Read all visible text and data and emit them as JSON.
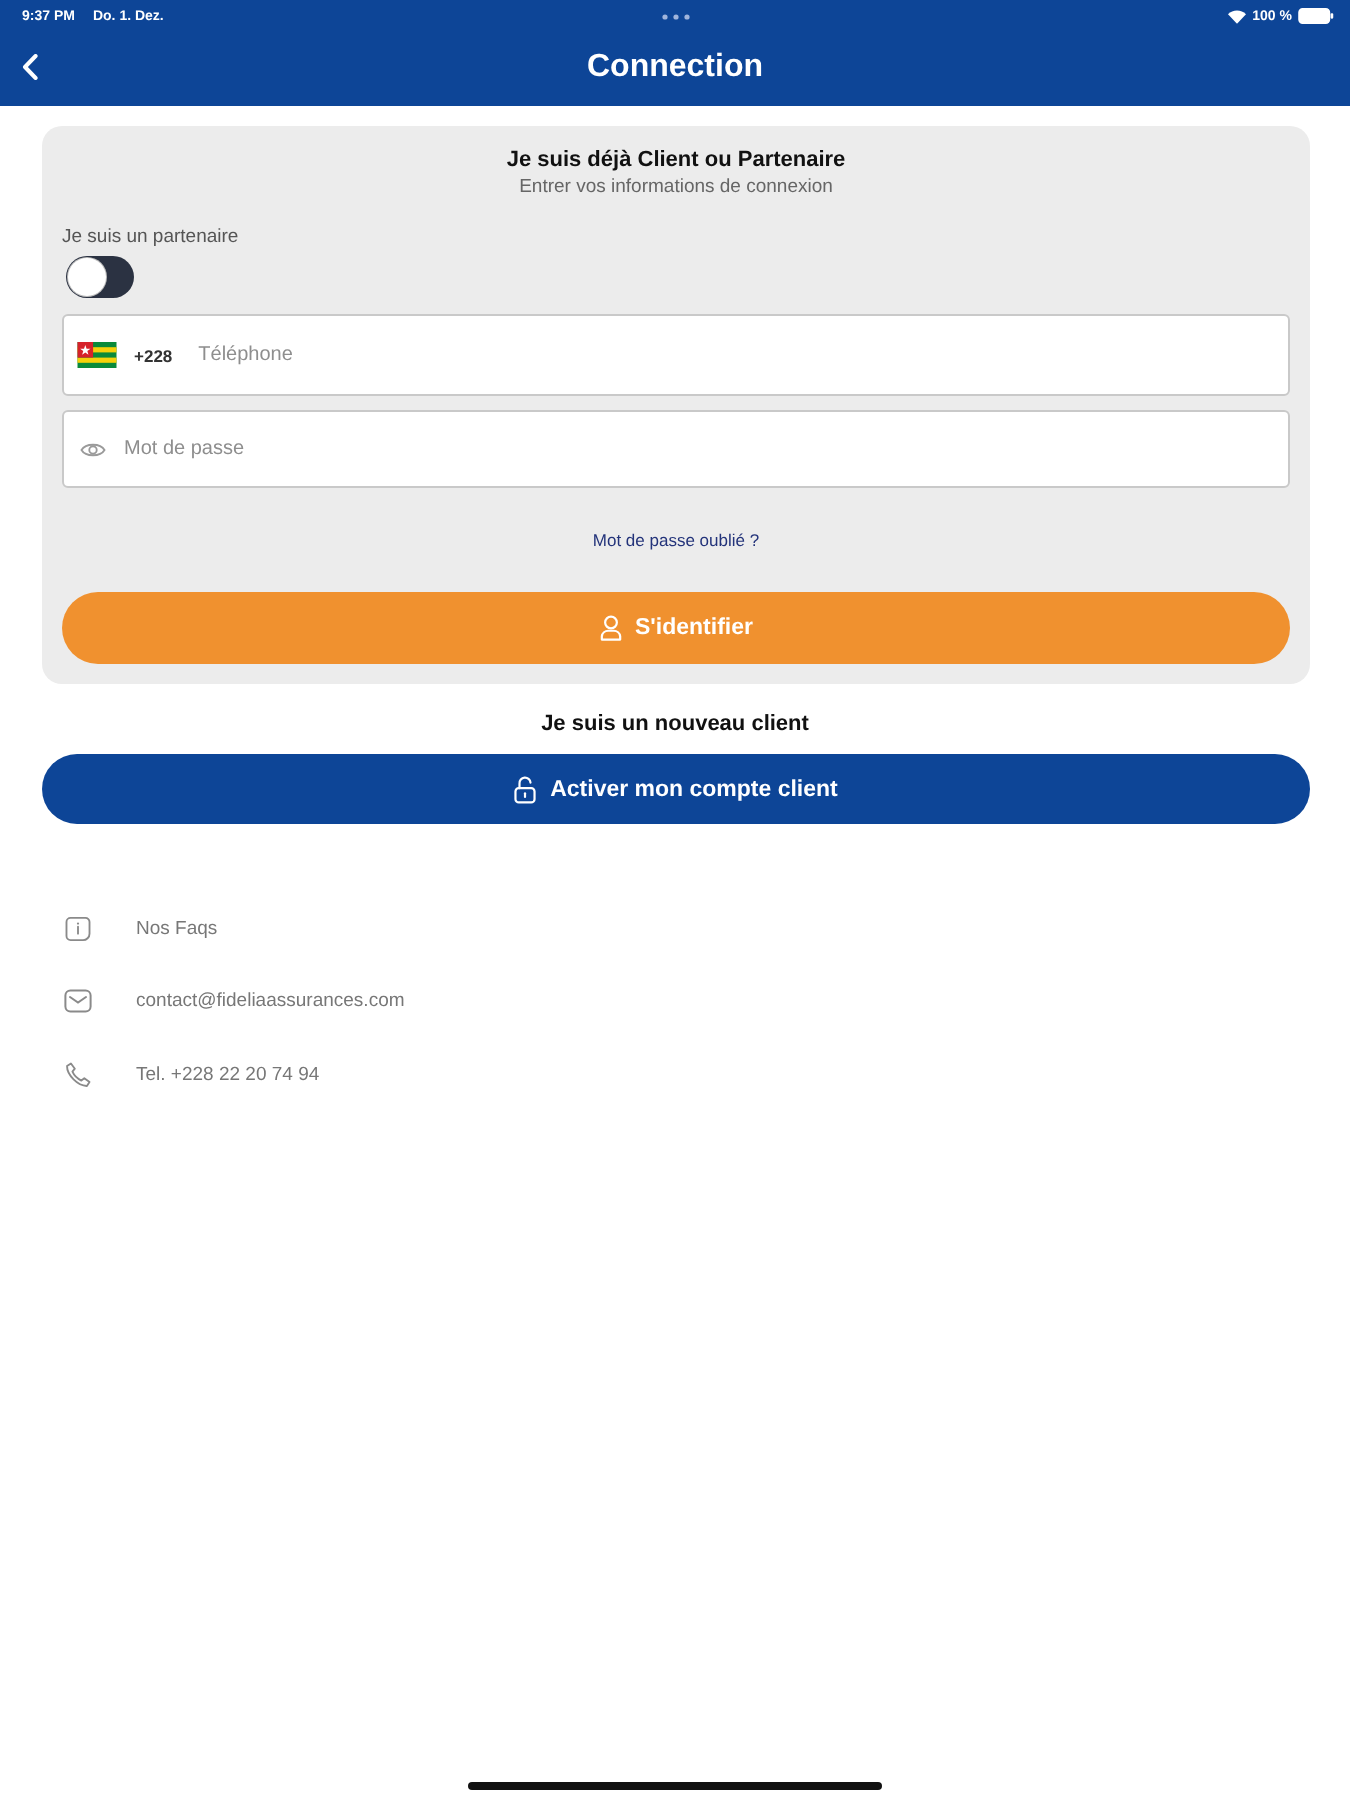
{
  "status_bar": {
    "time": "9:37 PM",
    "date": "Do. 1. Dez.",
    "battery": "100 %"
  },
  "header": {
    "title": "Connection"
  },
  "login": {
    "title": "Je suis déjà Client ou Partenaire",
    "subtitle": "Entrer vos informations de connexion",
    "partner_toggle": {
      "label": "Je suis un partenaire",
      "on": false
    },
    "phone_field": {
      "prefix": "+228",
      "placeholder": "Téléphone"
    },
    "password_field": {
      "placeholder": "Mot de passe"
    },
    "forgot_link": "Mot de passe oublié ?",
    "submit_button": "S'identifier"
  },
  "new_client": {
    "title": "Je suis un nouveau client",
    "button": "Activer mon compte client"
  },
  "contacts": [
    {
      "kind": "faq",
      "text": "Nos Faqs"
    },
    {
      "kind": "email",
      "text": "contact@fideliaassurances.com"
    },
    {
      "kind": "phone",
      "text": "Tel. +228 22 20 74 94"
    }
  ]
}
